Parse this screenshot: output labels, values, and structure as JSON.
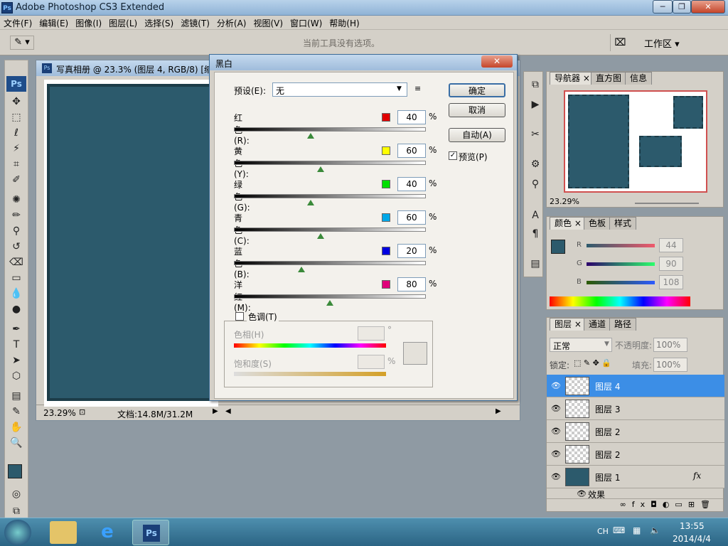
{
  "app": {
    "title": "Adobe Photoshop CS3 Extended",
    "icon": "Ps"
  },
  "window_controls": {
    "minimize": "─",
    "restore": "❐",
    "close": "✕"
  },
  "menu": [
    "文件(F)",
    "编辑(E)",
    "图像(I)",
    "图层(L)",
    "选择(S)",
    "滤镜(T)",
    "分析(A)",
    "视图(V)",
    "窗口(W)",
    "帮助(H)"
  ],
  "options_bar": {
    "hint": "当前工具没有选项。",
    "workspace": "工作区 ▾"
  },
  "document": {
    "title": "写真相册 @ 23.3% (图层 4, RGB/8) [缩",
    "zoom": "23.29%",
    "doc_info": "文档:14.8M/31.2M"
  },
  "dialog": {
    "title": "黑白",
    "preset_label": "预设(E):",
    "preset_value": "无",
    "ok": "确定",
    "cancel": "取消",
    "auto": "自动(A)",
    "preview": "预览(P)",
    "pct": "%",
    "channels": [
      {
        "label": "红色(R):",
        "value": "40",
        "color": "#e00000",
        "fraction": 0.4
      },
      {
        "label": "黄色(Y):",
        "value": "60",
        "color": "#ffff00",
        "fraction": 0.45
      },
      {
        "label": "绿色(G):",
        "value": "40",
        "color": "#00e000",
        "fraction": 0.4
      },
      {
        "label": "青色(C):",
        "value": "60",
        "color": "#00a8e8",
        "fraction": 0.45
      },
      {
        "label": "蓝色(B):",
        "value": "20",
        "color": "#0000e0",
        "fraction": 0.35
      },
      {
        "label": "洋红(M):",
        "value": "80",
        "color": "#e0007a",
        "fraction": 0.5
      }
    ],
    "tint": {
      "label": "色调(T)",
      "hue_label": "色相(H)",
      "hue_unit": "°",
      "sat_label": "饱和度(S)",
      "sat_unit": "%"
    }
  },
  "navigator": {
    "tabs": [
      "导航器",
      "直方图",
      "信息"
    ],
    "zoom": "23.29%"
  },
  "color_panel": {
    "tabs": [
      "颜色",
      "色板",
      "样式"
    ],
    "r": "44",
    "g": "90",
    "b": "108",
    "r_label": "R",
    "g_label": "G",
    "b_label": "B",
    "fg_color": "#2c5a6c"
  },
  "layers_panel": {
    "tabs": [
      "图层",
      "通道",
      "路径"
    ],
    "blend_mode": "正常",
    "opacity_label": "不透明度:",
    "opacity": "100%",
    "lock_label": "锁定:",
    "fill_label": "填充:",
    "fill": "100%",
    "layers": [
      "图层 4",
      "图层 3",
      "图层 2",
      "图层 2",
      "图层 1"
    ],
    "effects_label": "效果",
    "fx": "fx"
  },
  "taskbar": {
    "lang": "CH",
    "time": "13:55",
    "date": "2014/4/4"
  }
}
